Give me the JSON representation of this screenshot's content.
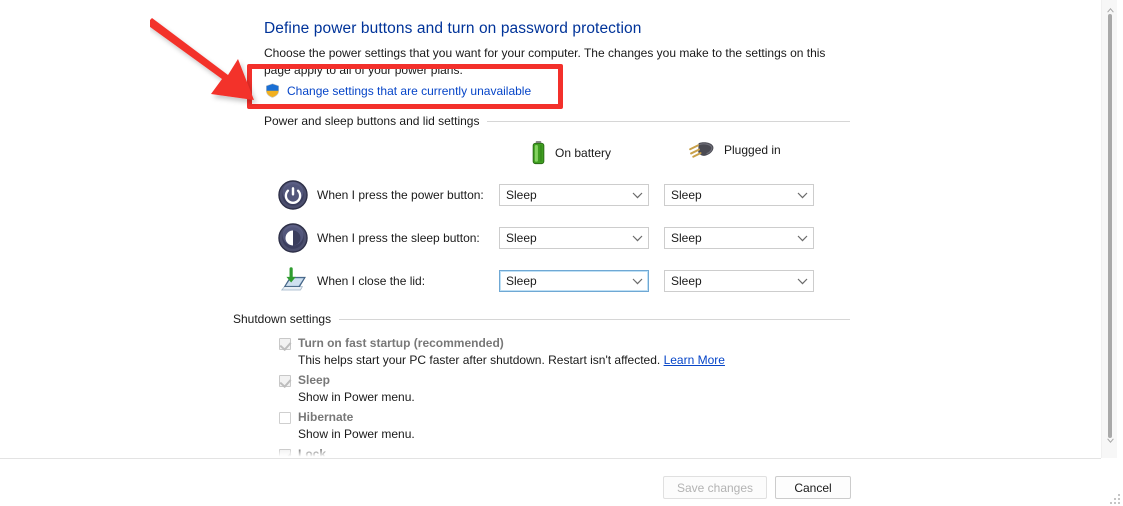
{
  "page": {
    "title": "Define power buttons and turn on password protection",
    "description": "Choose the power settings that you want for your computer. The changes you make to the settings on this page apply to all of your power plans.",
    "uac_link": "Change settings that are currently unavailable",
    "uac_icon": "shield-icon"
  },
  "groups": {
    "power_buttons": "Power and sleep buttons and lid settings",
    "shutdown": "Shutdown settings"
  },
  "columns": [
    {
      "label": "On battery",
      "icon": "battery-icon"
    },
    {
      "label": "Plugged in",
      "icon": "power-plug-icon"
    }
  ],
  "settings": [
    {
      "icon": "power-button-icon",
      "label": "When I press the power button:",
      "on_battery": "Sleep",
      "plugged_in": "Sleep",
      "on_battery_focused": false
    },
    {
      "icon": "sleep-button-icon",
      "label": "When I press the sleep button:",
      "on_battery": "Sleep",
      "plugged_in": "Sleep",
      "on_battery_focused": false
    },
    {
      "icon": "laptop-lid-icon",
      "label": "When I close the lid:",
      "on_battery": "Sleep",
      "plugged_in": "Sleep",
      "on_battery_focused": true
    }
  ],
  "shutdown_options": [
    {
      "title": "Turn on fast startup (recommended)",
      "checked": true,
      "disabled": true,
      "description": "This helps start your PC faster after shutdown. Restart isn't affected.",
      "link": "Learn More"
    },
    {
      "title": "Sleep",
      "checked": true,
      "disabled": true,
      "description": "Show in Power menu.",
      "link": ""
    },
    {
      "title": "Hibernate",
      "checked": false,
      "disabled": true,
      "description": "Show in Power menu.",
      "link": ""
    },
    {
      "title": "Lock",
      "checked": true,
      "disabled": true,
      "description": "",
      "link": ""
    }
  ],
  "footer": {
    "save_label": "Save changes",
    "save_enabled": false,
    "cancel_label": "Cancel",
    "cancel_enabled": true
  },
  "scrollbar": {
    "up_arrow": "chevron-up-icon",
    "down_arrow": "chevron-down-icon"
  },
  "annotation": {
    "highlight_color": "#f3302b",
    "target": "Change settings that are currently unavailable"
  },
  "colors": {
    "title_blue": "#003399",
    "link_blue": "#0645c8",
    "annotation_red": "#f3302b",
    "disabled_text": "#787878",
    "focus_border": "#6fa8d4"
  }
}
